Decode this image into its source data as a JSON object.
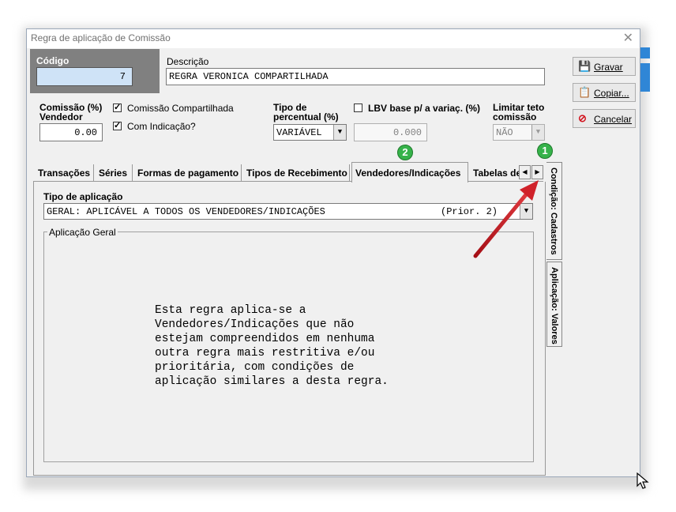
{
  "window": {
    "title": "Regra de aplicação de Comissão",
    "close_glyph": "✕"
  },
  "header": {
    "codigo_label": "Código",
    "codigo_value": "7",
    "descricao_label": "Descrição",
    "descricao_value": "REGRA VERONICA COMPARTILHADA"
  },
  "comissao": {
    "label_line1": "Comissão (%)",
    "label_line2": "Vendedor",
    "value": "0.00",
    "compartilhada_label": "Comissão Compartilhada",
    "compartilhada_checked": "✓",
    "indicacao_label": "Com Indicação?",
    "indicacao_checked": "✓"
  },
  "percentual": {
    "label_line1": "Tipo de",
    "label_line2": "percentual (%)",
    "value": "VARIÁVEL",
    "lbv_label": "LBV base p/ a variaç. (%)",
    "lbv_value": "0.000",
    "limitar_line1": "Limitar teto",
    "limitar_line2": "comissão",
    "limitar_value": "NÃO"
  },
  "buttons": {
    "gravar": "Gravar",
    "copiar": "Copiar...",
    "cancelar": "Cancelar"
  },
  "tabs": [
    "Transações",
    "Séries",
    "Formas de pagamento",
    "Tipos de Recebimento",
    "Vendedores/Indicações",
    "Tabelas de"
  ],
  "side_tabs": {
    "cadastros": "Condição: Cadastros",
    "valores": "Aplicação: Valores"
  },
  "badges": {
    "one": "1",
    "two": "2"
  },
  "aplicacao": {
    "tipo_label": "Tipo de aplicação",
    "tipo_value": "GERAL: APLICÁVEL A TODOS OS VENDEDORES/INDICAÇÕES",
    "tipo_prior": "(Prior. 2)",
    "group_title": "Aplicação Geral",
    "text_lines": [
      "Esta regra aplica-se a",
      "Vendedores/Indicações que não",
      "estejam compreendidos em nenhuma",
      "outra regra mais restritiva e/ou",
      "prioritária, com condições de",
      "aplicação similares a desta regra."
    ]
  },
  "colors": {
    "accent": "#2f86d6",
    "badge_green": "#36b24a",
    "arrow_red": "#c0141c"
  }
}
